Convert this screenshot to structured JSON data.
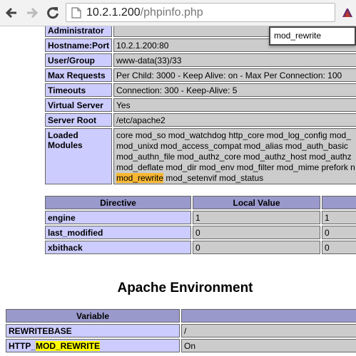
{
  "browser": {
    "url_host": "10.2.1.200",
    "url_path": "/phpinfo.php"
  },
  "find": {
    "query": "mod_rewrite"
  },
  "server_table": {
    "rows": [
      {
        "key": "Administrator",
        "value": ""
      },
      {
        "key": "Hostname:Port",
        "value": "10.2.1.200:80"
      },
      {
        "key": "User/Group",
        "value": "www-data(33)/33"
      },
      {
        "key": "Max Requests",
        "value": "Per Child: 3000 - Keep Alive: on - Max Per Connection: 100"
      },
      {
        "key": "Timeouts",
        "value": "Connection: 300 - Keep-Alive: 5"
      },
      {
        "key": "Virtual Server",
        "value": "Yes"
      },
      {
        "key": "Server Root",
        "value": "/etc/apache2"
      }
    ],
    "modules": {
      "key": "Loaded Modules",
      "lines": [
        "core mod_so mod_watchdog http_core mod_log_config mod_",
        "mod_unixd mod_access_compat mod_alias mod_auth_basic",
        "mod_authn_file mod_authz_core mod_authz_host mod_authz",
        "mod_deflate mod_dir mod_env mod_filter mod_mime prefork n"
      ],
      "last_highlight": "mod_rewrite",
      "last_rest": " mod_setenvif mod_status"
    }
  },
  "directive_table": {
    "headers": [
      "Directive",
      "Local Value",
      ""
    ],
    "rows": [
      {
        "directive": "engine",
        "local": "1",
        "master": "1"
      },
      {
        "directive": "last_modified",
        "local": "0",
        "master": "0"
      },
      {
        "directive": "xbithack",
        "local": "0",
        "master": "0"
      }
    ]
  },
  "environment": {
    "title": "Apache Environment",
    "headers": [
      "Variable",
      ""
    ],
    "rows": [
      {
        "var": "REWRITEBASE",
        "var_hl": "",
        "var_after": "",
        "value": "/"
      },
      {
        "var": "HTTP_",
        "var_hl": "MOD_REWRITE",
        "var_after": "",
        "value": "On"
      }
    ]
  }
}
